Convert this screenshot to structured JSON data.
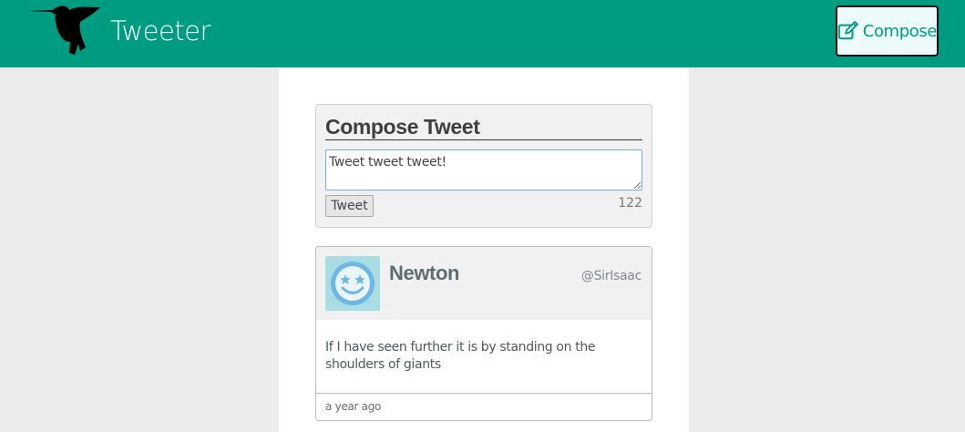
{
  "header": {
    "app_title": "Tweeter",
    "compose_button_label": "Compose",
    "compose_icon": "edit-icon",
    "logo_icon": "hummingbird-logo",
    "background_color": "#009c82"
  },
  "composer": {
    "title": "Compose Tweet",
    "input_value": "Tweet tweet tweet!",
    "submit_label": "Tweet",
    "char_count": "122"
  },
  "tweets": [
    {
      "name": "Newton",
      "handle": "@SirIsaac",
      "text": "If I have seen further it is by standing on the shoulders of giants",
      "timestamp": "a year ago",
      "avatar_icon": "smiley-star-eyes-icon"
    }
  ]
}
